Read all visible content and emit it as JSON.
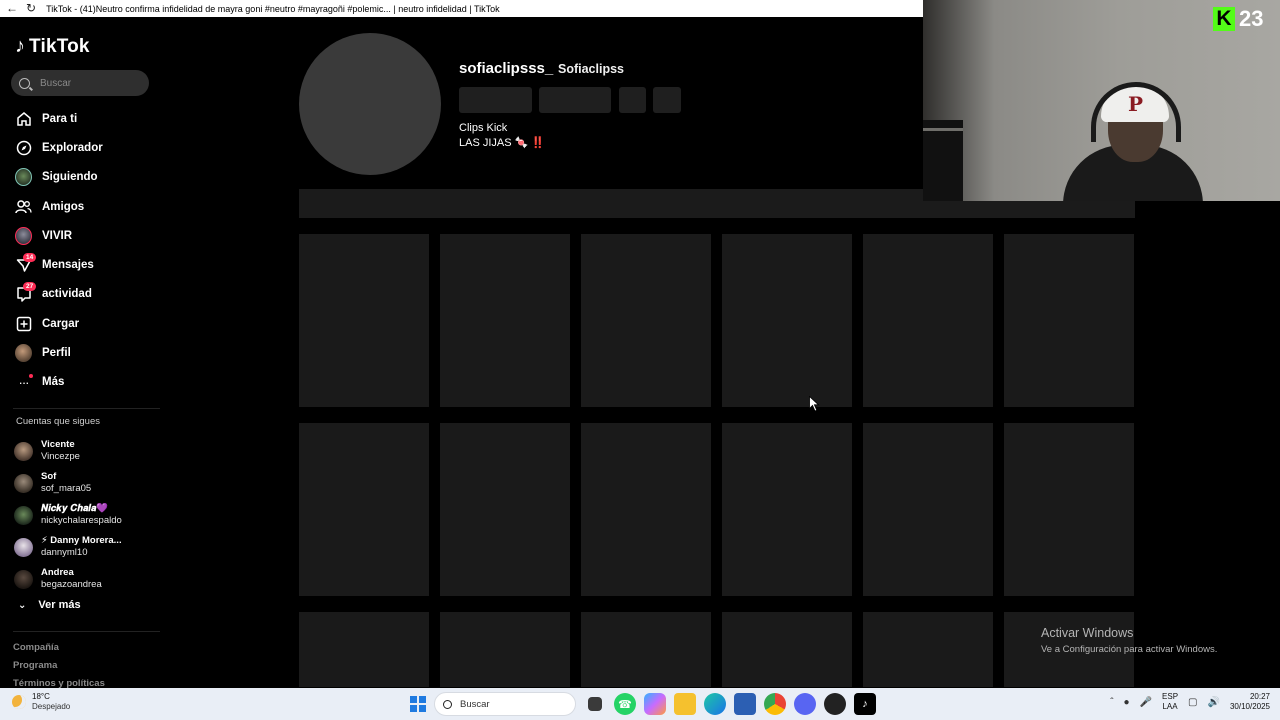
{
  "browser": {
    "tab_title": "TikTok - (41)Neutro confirma infidelidad de mayra goni #neutro #mayragoñi #polemic... | neutro infidelidad | TikTok"
  },
  "sidebar": {
    "logo_text": "TikTok",
    "search_placeholder": "Buscar",
    "nav": [
      {
        "label": "Para ti",
        "icon": "home-icon"
      },
      {
        "label": "Explorador",
        "icon": "compass-icon"
      },
      {
        "label": "Siguiendo",
        "icon": "following-avatar-icon"
      },
      {
        "label": "Amigos",
        "icon": "friends-icon"
      },
      {
        "label": "VIVIR",
        "icon": "live-avatar-icon"
      },
      {
        "label": "Mensajes",
        "icon": "messages-icon",
        "badge": "14"
      },
      {
        "label": "actividad",
        "icon": "activity-icon",
        "badge": "27"
      },
      {
        "label": "Cargar",
        "icon": "upload-icon"
      },
      {
        "label": "Perfil",
        "icon": "profile-avatar-icon"
      },
      {
        "label": "Más",
        "icon": "more-icon"
      }
    ],
    "following_heading": "Cuentas que sigues",
    "following": [
      {
        "name": "Vicente",
        "handle": "Vincezpe"
      },
      {
        "name": "Sof",
        "handle": "sof_mara05"
      },
      {
        "name": "𝑵𝒊𝒄𝒌𝒚 𝑪𝒉𝒂𝒍𝒂💜",
        "handle": "nickychalarespaldo"
      },
      {
        "name": "⚡ Danny Morera...",
        "handle": "dannyml10"
      },
      {
        "name": "Andrea",
        "handle": "begazoandrea"
      }
    ],
    "see_more": "Ver más",
    "footer": [
      "Compañía",
      "Programa",
      "Términos y políticas"
    ]
  },
  "profile": {
    "username": "sofiaclipsss_",
    "nickname": "Sofiaclipss",
    "bio_line1": "Clips Kick",
    "bio_line2": "LAS JIJAS 🍬 ‼️"
  },
  "overlay": {
    "kick_letter": "K",
    "kick_number": "23",
    "cap_letter": "P"
  },
  "watermark": {
    "title": "Activar Windows",
    "subtitle": "Ve a Configuración para activar Windows."
  },
  "taskbar": {
    "temperature": "18°C",
    "weather": "Despejado",
    "search_placeholder": "Buscar",
    "language": "ESP",
    "language_sub": "LAA",
    "time": "20:27",
    "date": "30/10/2025",
    "apps": [
      "file-explorer-icon",
      "whatsapp-icon",
      "copilot-icon",
      "folder-icon",
      "edge-icon",
      "store-icon",
      "chrome-icon",
      "discord-icon",
      "obs-icon",
      "tiktok-icon"
    ]
  }
}
